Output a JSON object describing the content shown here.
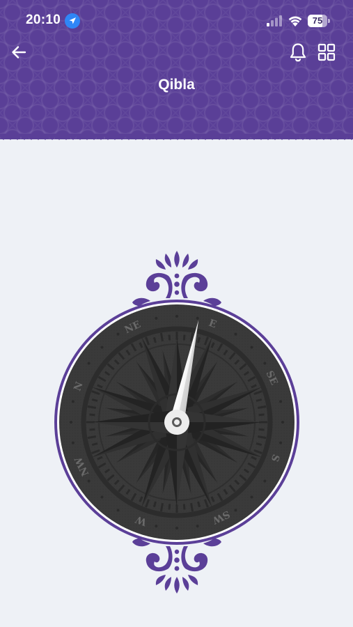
{
  "status_bar": {
    "time": "20:10",
    "battery": "75",
    "battery_level": 0.75,
    "icons": [
      "location-arrow-icon",
      "signal-icon",
      "wifi-icon",
      "battery-icon"
    ]
  },
  "header": {
    "title": "Qibla",
    "icons": [
      "back-arrow-icon",
      "bell-icon",
      "grid-icon"
    ]
  },
  "compass": {
    "directions": [
      "E",
      "SE",
      "S",
      "SW",
      "W",
      "NW",
      "N",
      "NE"
    ],
    "needle_heading_deg": 12
  },
  "colors": {
    "header_bg": "#5A3F97",
    "page_bg": "#EEF1F6",
    "accent_purple": "#5B3F98",
    "dial_dark": "#3B3B3B",
    "needle": "#F2F2F2"
  }
}
